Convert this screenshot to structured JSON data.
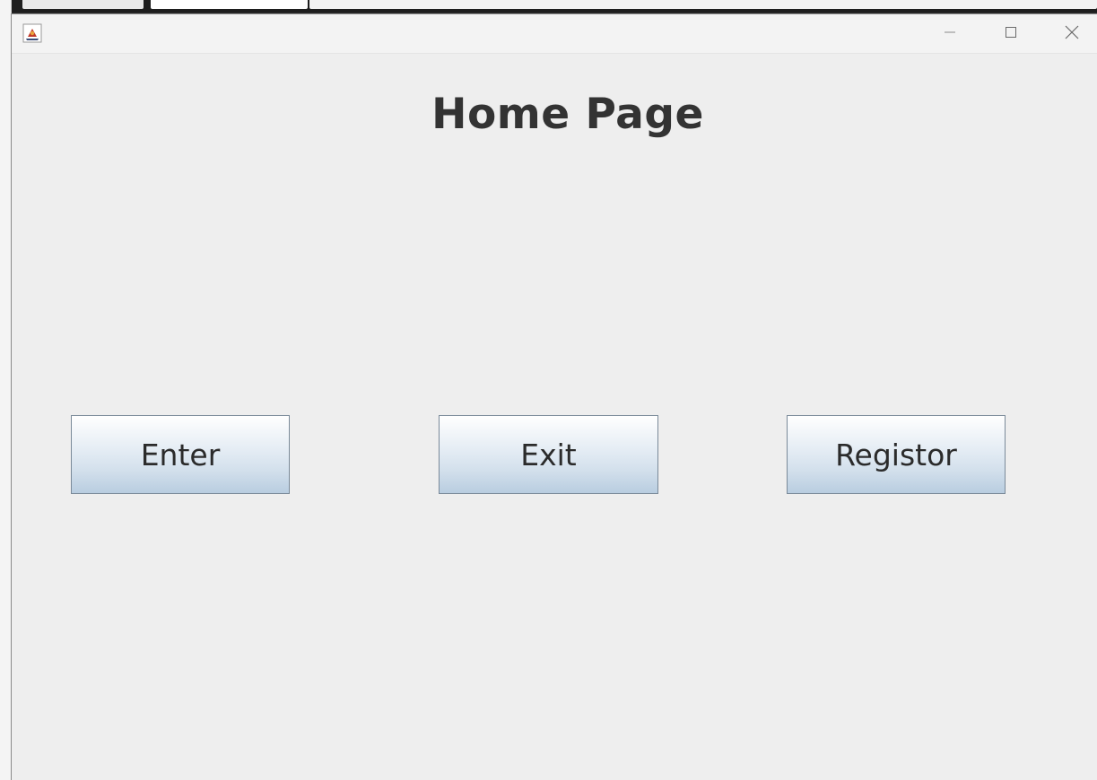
{
  "window": {
    "heading": "Home Page",
    "icons": {
      "app": "java-app-icon",
      "minimize": "minimize-icon",
      "maximize": "maximize-icon",
      "close": "close-icon"
    }
  },
  "buttons": {
    "enter": "Enter",
    "exit": "Exit",
    "registor": "Registor"
  },
  "colors": {
    "window_bg": "#eeeeee",
    "heading": "#333333",
    "button_border": "#7a8a99",
    "button_gradient_top": "#ffffff",
    "button_gradient_bottom": "#b9cde0"
  }
}
